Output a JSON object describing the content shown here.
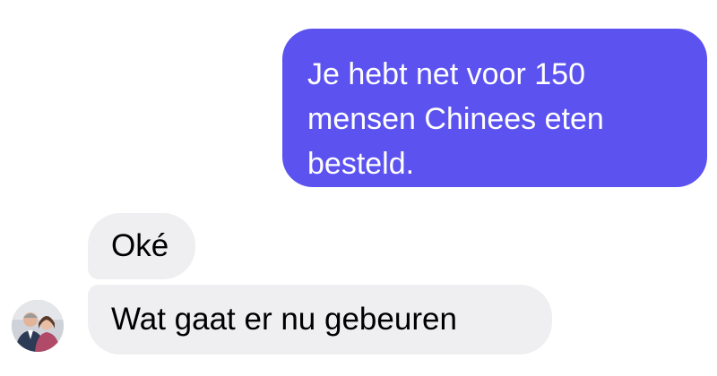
{
  "messages": [
    {
      "direction": "outgoing",
      "text": "Je hebt net voor 150\nmensen Chinees eten\nbesteld."
    },
    {
      "direction": "incoming",
      "text": "Oké"
    },
    {
      "direction": "incoming",
      "text": "Wat gaat er nu gebeuren"
    }
  ],
  "colors": {
    "outgoing_bubble": "#5b52f0",
    "incoming_bubble": "#efeff1",
    "background": "#ffffff"
  },
  "avatar": {
    "icon": "contact-photo"
  }
}
